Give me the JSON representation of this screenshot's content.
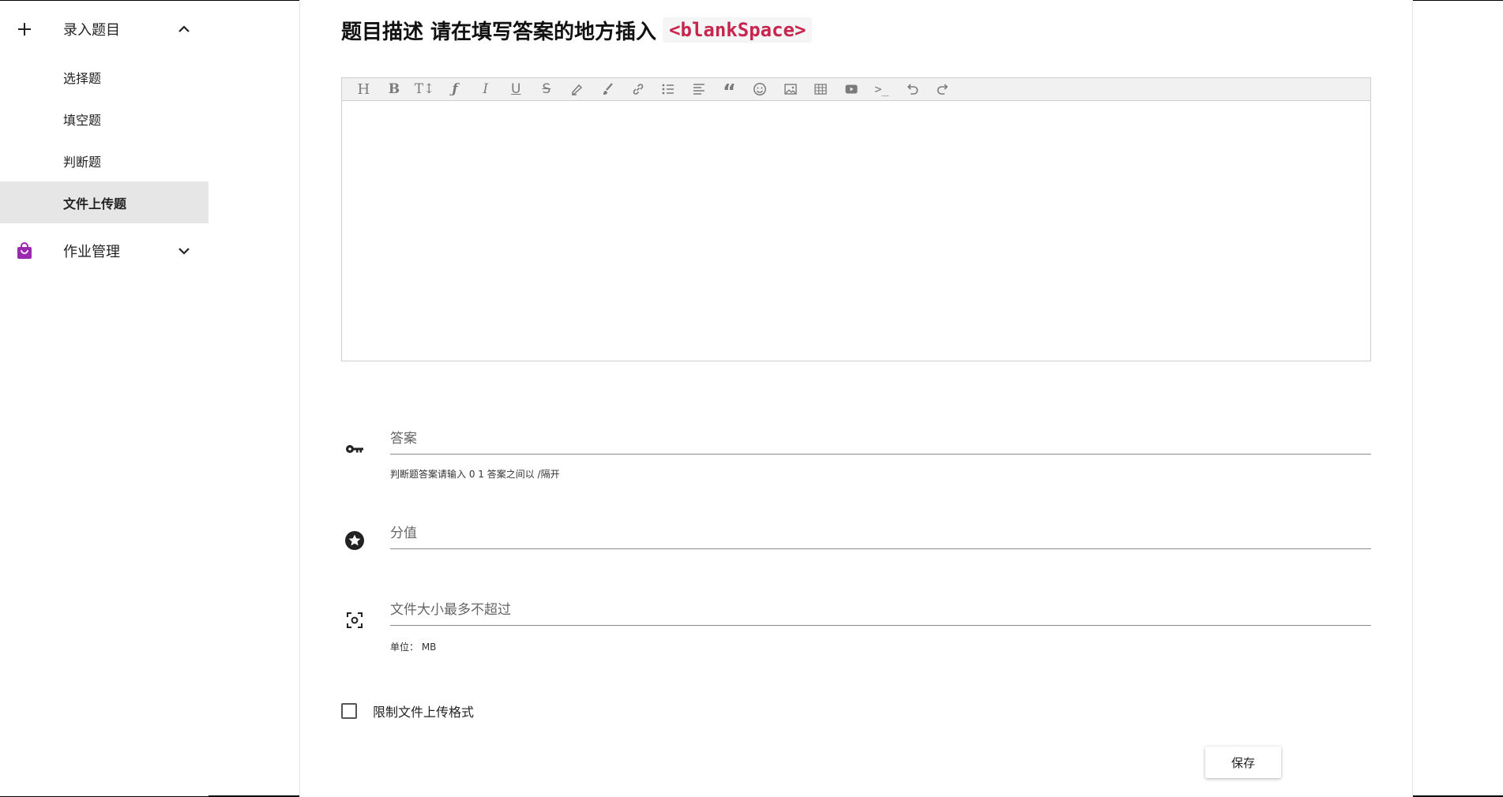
{
  "sidebar": {
    "group_entry": {
      "label": "录入题目",
      "icon": "plus-icon",
      "expanded": true
    },
    "items": [
      {
        "label": "选择题"
      },
      {
        "label": "填空题"
      },
      {
        "label": "判断题"
      },
      {
        "label": "文件上传题",
        "active": true
      }
    ],
    "group_homework": {
      "label": "作业管理",
      "icon": "shopping-bag-icon",
      "icon_color": "#9c27b0",
      "expanded": false
    }
  },
  "main": {
    "title": "题目描述 请在填写答案的地方插入",
    "title_code": "<blankSpace>",
    "editor": {
      "toolbar": [
        "heading-icon",
        "bold-icon",
        "text-size-icon",
        "font-icon",
        "italic-icon",
        "underline-icon",
        "strikethrough-icon",
        "highlighter-icon",
        "brush-icon",
        "link-icon",
        "bullet-list-icon",
        "align-icon",
        "quote-icon",
        "emoji-icon",
        "image-icon",
        "table-icon",
        "video-icon",
        "code-icon",
        "undo-icon",
        "redo-icon"
      ],
      "content": ""
    },
    "answer": {
      "placeholder": "答案",
      "value": "",
      "hint": "判断题答案请输入 0 1 答案之间以 /隔开",
      "icon": "key-icon"
    },
    "score": {
      "placeholder": "分值",
      "value": "",
      "icon": "star-circle-icon"
    },
    "file_size": {
      "placeholder": "文件大小最多不超过",
      "value": "",
      "hint": "单位： MB",
      "icon": "center-focus-icon"
    },
    "restrict_format": {
      "label": "限制文件上传格式",
      "checked": false
    },
    "save_label": "保存"
  }
}
